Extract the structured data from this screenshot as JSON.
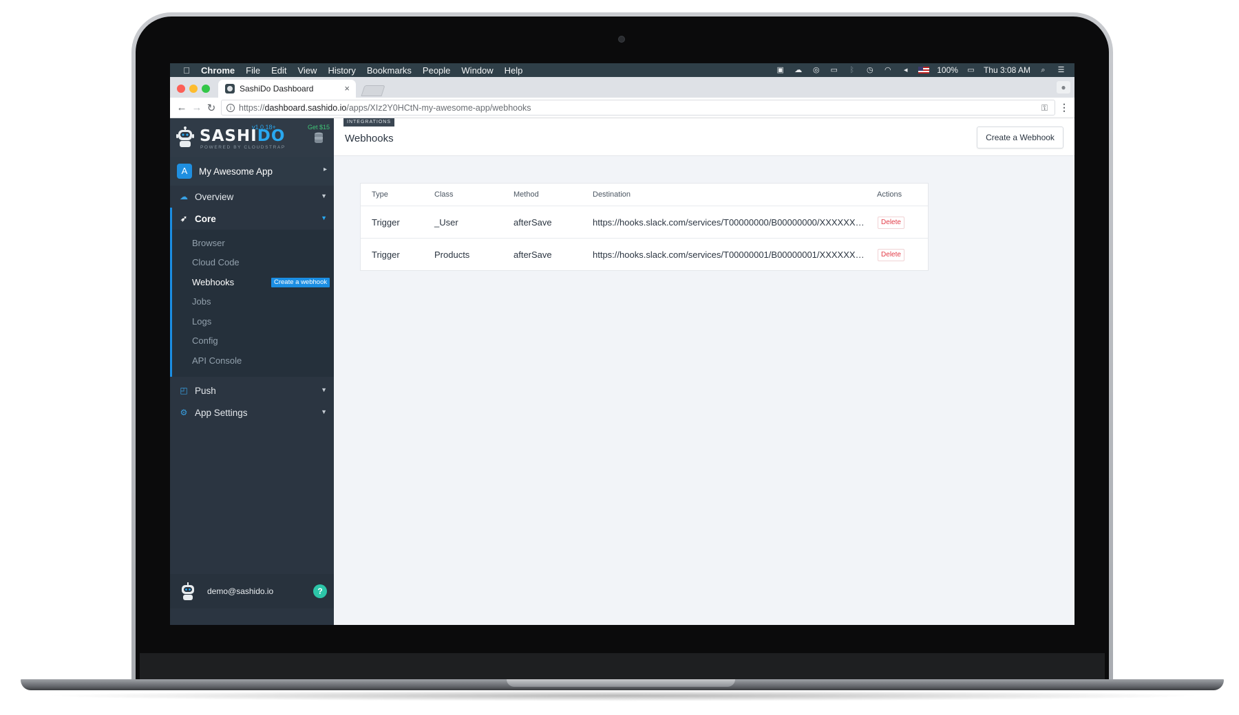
{
  "menubar": {
    "apple_glyph": "",
    "app_name": "Chrome",
    "menus": [
      "File",
      "Edit",
      "View",
      "History",
      "Bookmarks",
      "People",
      "Window",
      "Help"
    ],
    "battery": "100%",
    "clock": "Thu 3:08 AM",
    "tray_icons": [
      "notification-icon",
      "creative-cloud-icon",
      "sync-icon",
      "airplay-icon",
      "bluetooth-icon",
      "time-machine-icon",
      "wifi-icon",
      "volume-icon",
      "flag-icon",
      "battery-icon",
      "spotlight-icon",
      "list-icon"
    ]
  },
  "browser": {
    "tab_title": "SashiDo Dashboard",
    "url_scheme": "https://",
    "url_host": "dashboard.sashido.io",
    "url_path": "/apps/XIz2Y0HCtN-my-awesome-app/webhooks"
  },
  "sidebar": {
    "brand_name": "SASHI",
    "brand_name_accent": "DO",
    "tagline": "POWERED BY CLOUDSTRAP",
    "version": "v1.0.18+",
    "credit": "Get $15",
    "app_name": "My Awesome App",
    "nav": {
      "overview": "Overview",
      "core": "Core",
      "push": "Push",
      "app_settings": "App Settings"
    },
    "core_items": {
      "browser": "Browser",
      "cloud_code": "Cloud Code",
      "webhooks": "Webhooks",
      "jobs": "Jobs",
      "logs": "Logs",
      "config": "Config",
      "api_console": "API Console"
    },
    "create_webhook_pill": "Create a webhook",
    "user_email": "demo@sashido.io",
    "help_glyph": "?"
  },
  "header": {
    "section_tag": "INTEGRATIONS",
    "title": "Webhooks",
    "create_button": "Create a Webhook"
  },
  "table": {
    "columns": {
      "type": "Type",
      "class": "Class",
      "method": "Method",
      "destination": "Destination",
      "actions": "Actions"
    },
    "rows": [
      {
        "type": "Trigger",
        "class": "_User",
        "method": "afterSave",
        "destination": "https://hooks.slack.com/services/T00000000/B00000000/XXXXXXX...",
        "action": "Delete"
      },
      {
        "type": "Trigger",
        "class": "Products",
        "method": "afterSave",
        "destination": "https://hooks.slack.com/services/T00000001/B00000001/XXXXXXX...",
        "action": "Delete"
      }
    ]
  },
  "colors": {
    "accent": "#1b8ee3",
    "sidebar_bg": "#2b3541",
    "danger": "#e23a46",
    "help": "#2cc5a8",
    "menubar_bg": "#2f3f48"
  }
}
